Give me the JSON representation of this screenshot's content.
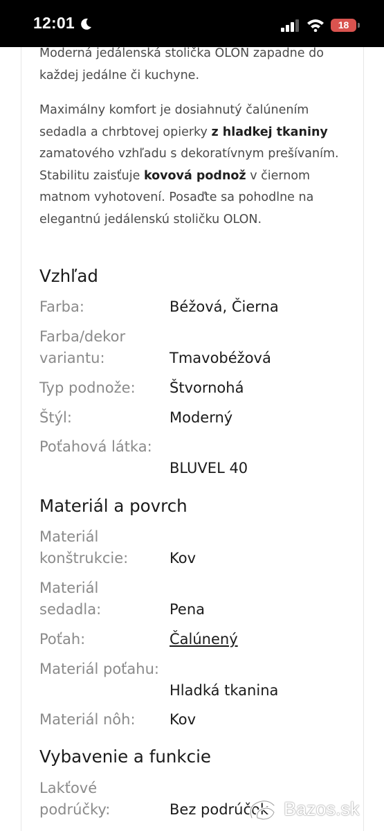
{
  "status_bar": {
    "time": "12:01",
    "battery": "18",
    "icons": [
      "moon-icon",
      "signal-icon",
      "wifi-icon",
      "battery-icon"
    ]
  },
  "description": {
    "intro": "Moderná jedálenská stolička OLON zapadne do každej jedálne či kuchyne.",
    "p2_part1": "Maximálny komfort je dosiahnutý čalúnením sedadla a chrbtovej opierky ",
    "p2_bold1": "z hladkej tkaniny",
    "p2_part2": " zamatového vzhľadu s dekoratívnym prešívaním. Stabilitu zaisťuje ",
    "p2_bold2": "kovová podnož",
    "p2_part3": " v čiernom matnom vyhotovení. Posaďte sa pohodlne na elegantnú jedálenskú stoličku OLON."
  },
  "sections": {
    "appearance": {
      "title": "Vzhľad",
      "farba_label": "Farba:",
      "farba_value": "Béžová, Čierna",
      "dekor_label": "Farba/dekor variantu:",
      "dekor_value": "Tmavobéžová",
      "podnoz_label": "Typ podnože:",
      "podnoz_value": "Štvornohá",
      "styl_label": "Štýl:",
      "styl_value": "Moderný",
      "latka_label": "Poťahová látka:",
      "latka_value": "BLUVEL 40"
    },
    "material": {
      "title": "Materiál a povrch",
      "konstrukcia_label": "Materiál konštrukcie:",
      "konstrukcia_value": "Kov",
      "sedadlo_label": "Materiál sedadla:",
      "sedadlo_value": "Pena",
      "potah_label": "Poťah:",
      "potah_value": "Čalúnený",
      "material_potahu_label": "Materiál poťahu:",
      "material_potahu_value": "Hladká tkanina",
      "noh_label": "Materiál nôh:",
      "noh_value": "Kov"
    },
    "features": {
      "title": "Vybavenie a funkcie",
      "podrucky_label": "Lakťové podrúčky:",
      "podrucky_value": "Bez podrúčok"
    }
  },
  "watermark": {
    "text": "Bazos.sk"
  }
}
